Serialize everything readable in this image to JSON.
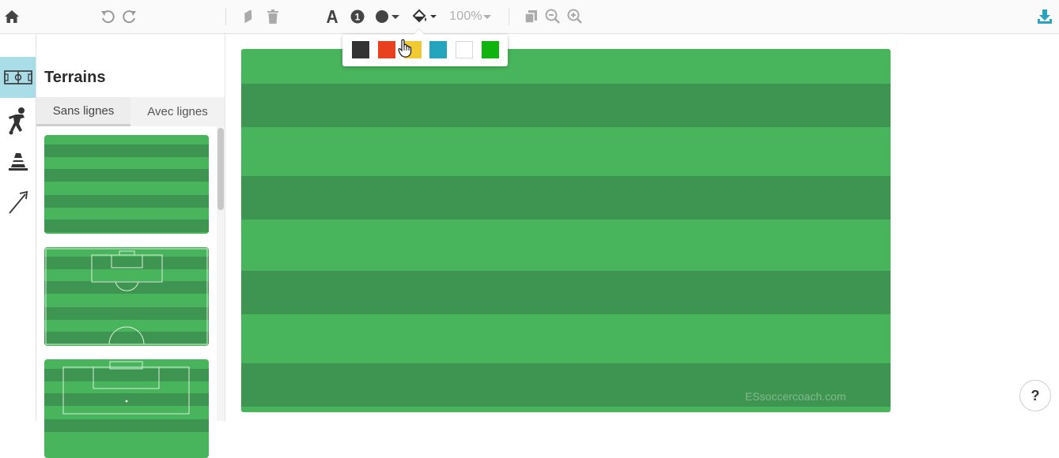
{
  "toolbar": {
    "zoom_label": "100%",
    "icons": [
      "home-icon",
      "undo-icon",
      "redo-icon",
      "eraser-icon",
      "trash-icon",
      "text-icon",
      "number-icon",
      "circle-shape-icon",
      "fill-color-icon",
      "copy-icon",
      "zoom-out-icon",
      "zoom-in-icon",
      "download-icon"
    ]
  },
  "color_picker": {
    "colors": [
      "#333333",
      "#e8411f",
      "#f0c933",
      "#25a5bd",
      "#ffffff",
      "#0fb40f"
    ]
  },
  "sidebar": {
    "rail_items": [
      "field-icon",
      "player-icon",
      "cone-icon",
      "arrow-icon"
    ],
    "active_item": "field-icon"
  },
  "terrains": {
    "title": "Terrains",
    "tabs": [
      {
        "label": "Sans lignes",
        "active": true
      },
      {
        "label": "Avec lignes",
        "active": false
      }
    ],
    "thumbnails": [
      "plain-stripes",
      "half-pitch-lines",
      "full-pitch-lines"
    ]
  },
  "canvas": {
    "watermark": "ESsoccercoach.com",
    "colors": {
      "light": "#48b45b",
      "dark": "#3e9451"
    }
  },
  "help": {
    "label": "?"
  }
}
